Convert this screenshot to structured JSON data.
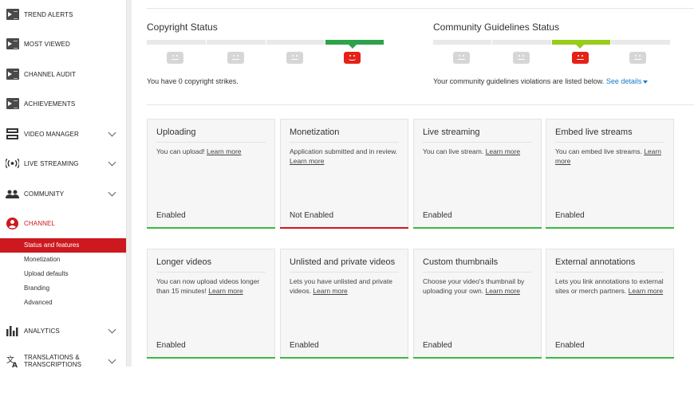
{
  "sidebar": {
    "items": [
      {
        "label": "TREND ALERTS",
        "icon": "yt-studio-icon"
      },
      {
        "label": "MOST VIEWED",
        "icon": "yt-studio-icon"
      },
      {
        "label": "CHANNEL AUDIT",
        "icon": "yt-studio-icon"
      },
      {
        "label": "ACHIEVEMENTS",
        "icon": "yt-studio-icon"
      },
      {
        "label": "VIDEO MANAGER",
        "icon": "video-manager-icon"
      },
      {
        "label": "LIVE STREAMING",
        "icon": "live-streaming-icon"
      },
      {
        "label": "COMMUNITY",
        "icon": "community-icon"
      },
      {
        "label": "CHANNEL",
        "icon": "channel-icon"
      }
    ],
    "channel_sub": [
      "Status and features",
      "Monetization",
      "Upload defaults",
      "Branding",
      "Advanced"
    ],
    "bottom_items": [
      {
        "label": "ANALYTICS",
        "icon": "analytics-icon"
      },
      {
        "label": "TRANSLATIONS & TRANSCRIPTIONS",
        "icon": "translate-icon"
      }
    ],
    "channel_color": "#cc181e"
  },
  "copyright": {
    "title": "Copyright Status",
    "note": "You have 0 copyright strikes."
  },
  "community": {
    "title": "Community Guidelines Status",
    "note": "Your community guidelines violations are listed below.",
    "link": "See details"
  },
  "features": [
    {
      "title": "Uploading",
      "desc": "You can upload!",
      "link": "Learn more",
      "state": "Enabled"
    },
    {
      "title": "Monetization",
      "desc": "Application submitted and in review.",
      "link": "Learn more",
      "state": "Not Enabled"
    },
    {
      "title": "Live streaming",
      "desc": "You can live stream.",
      "link": "Learn more",
      "state": "Enabled"
    },
    {
      "title": "Embed live streams",
      "desc": "You can embed live streams.",
      "link": "Learn more",
      "state": "Enabled"
    },
    {
      "title": "Longer videos",
      "desc": "You can now upload videos longer than 15 minutes!",
      "link": "Learn more",
      "state": "Enabled"
    },
    {
      "title": "Unlisted and private videos",
      "desc": "Lets you have unlisted and private videos.",
      "link": "Learn more",
      "state": "Enabled"
    },
    {
      "title": "Custom thumbnails",
      "desc": "Choose your video's thumbnail by uploading your own.",
      "link": "Learn more",
      "state": "Enabled"
    },
    {
      "title": "External annotations",
      "desc": "Lets you link annotations to external sites or merch partners.",
      "link": "Learn more",
      "state": "Enabled"
    }
  ],
  "colors": {
    "enabled": "#3cb942",
    "not_enabled": "#cc181e",
    "link": "#167ac6",
    "good_status": "#2ea24b",
    "cg_status": "#97cc1a"
  }
}
